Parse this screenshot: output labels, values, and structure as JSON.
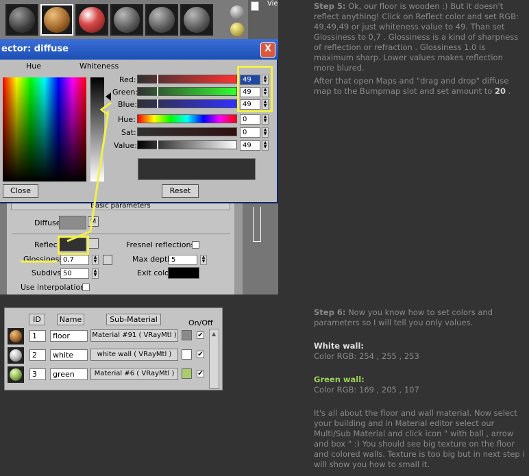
{
  "top_screenshot": {
    "viewport_label": "Vie",
    "dialog": {
      "title": "ector: diffuse",
      "hue_label": "Hue",
      "whiteness_label": "Whiteness",
      "red_label": "Red:",
      "green_label": "Green:",
      "blue_label": "Blue:",
      "hue2_label": "Hue:",
      "sat_label": "Sat:",
      "value_label": "Value:",
      "red_value": "49",
      "green_value": "49",
      "blue_value": "49",
      "hue_value": "0",
      "sat_value": "0",
      "value_value": "49",
      "close_button": "Close",
      "reset_button": "Reset",
      "close_x": "X"
    },
    "panel": {
      "basic_parameters": "Basic parameters",
      "diffuse_label": "Diffuse",
      "diffuse_map_button": "M",
      "reflect_label": "Reflect",
      "fresnel_label": "Fresnel reflections",
      "glossiness_label": "Glossiness",
      "glossiness_value": "0,7",
      "max_depth_label": "Max depth",
      "max_depth_value": "5",
      "subdivs_label": "Subdivs",
      "subdivs_value": "50",
      "exit_color_label": "Exit color",
      "use_interpolation_label": "Use interpolation"
    },
    "colors": {
      "diffuse_swatch": "#8c8c8c",
      "reflect_swatch": "#313131",
      "exit_color": "#000000",
      "highlight": "#f3f04b"
    }
  },
  "bottom_screenshot": {
    "headers": {
      "id": "ID",
      "name": "Name",
      "sub_material": "Sub-Material",
      "on_off": "On/Off"
    },
    "rows": [
      {
        "id": "1",
        "name": "floor",
        "sub_material": "Material #91  ( VRayMtl )",
        "color": "#8a8a8a",
        "on": "✔"
      },
      {
        "id": "2",
        "name": "white",
        "sub_material": "white wall  ( VRayMtl )",
        "color": "#ffffff",
        "on": "✔"
      },
      {
        "id": "3",
        "name": "green",
        "sub_material": "Material #6  ( VRayMtl )",
        "color": "#a9cd6b",
        "on": "✔"
      }
    ]
  },
  "text": {
    "step5_label": "Step 5:",
    "step5_body": "Ok, our floor is wooden :) But it doesn't reflect anything! Click on Reflect color and set RGB: 49,49,49 or just whiteness value to 49. Than set Glossiness to 0,7 . Glossiness is a kind of sharpness of reflection or refraction . Glossiness 1.0 is maximum sharp. Lower values makes reflection more blured.",
    "step5_maps": "After that open Maps and \"drag and drop\" diffuse map to the Bumpmap slot and set amount to",
    "step5_amount": "20",
    "step5_end": ".",
    "step6_label": "Step 6:",
    "step6_body": "Now you know how to set colors and parameters so I will tell you only values.",
    "white_wall_title": "White wall:",
    "white_wall_rgb": "Color RGB: 254 , 255 , 253",
    "green_wall_title": "Green wall:",
    "green_wall_rgb": "Color RGB: 169 , 205 , 107",
    "final_paragraph": "It's all about the floor and wall material. Now select your building and in Material editor select our Multi/Sub Material and click icon \" with ball , arrow and box \" :) You should see big texture on the floor and colored walls. Texture is too big but in next step i will show you how to small it."
  }
}
